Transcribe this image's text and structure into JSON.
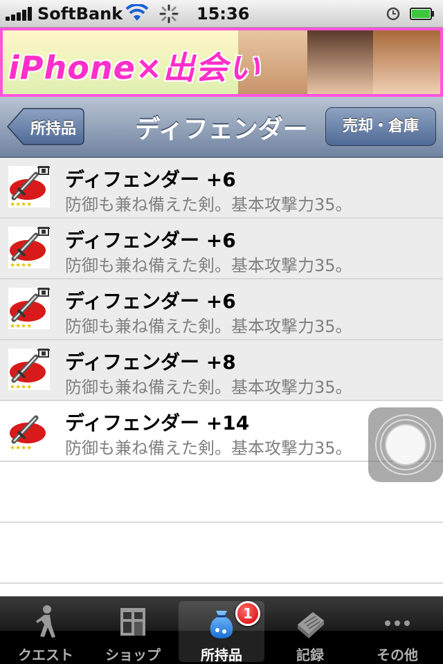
{
  "status_bar": {
    "carrier": "SoftBank",
    "time": "15:36"
  },
  "banner": {
    "text": "iPhone×出会い"
  },
  "nav": {
    "back_label": "所持品",
    "title": "ディフェンダー",
    "right_label": "売却・倉庫"
  },
  "items": [
    {
      "title": "ディフェンダー +6",
      "desc": "防御も兼ね備えた剣。基本攻撃力35。",
      "stored": true
    },
    {
      "title": "ディフェンダー +6",
      "desc": "防御も兼ね備えた剣。基本攻撃力35。",
      "stored": true
    },
    {
      "title": "ディフェンダー +6",
      "desc": "防御も兼ね備えた剣。基本攻撃力35。",
      "stored": true
    },
    {
      "title": "ディフェンダー +8",
      "desc": "防御も兼ね備えた剣。基本攻撃力35。",
      "stored": true
    },
    {
      "title": "ディフェンダー +14",
      "desc": "防御も兼ね備えた剣。基本攻撃力35。",
      "stored": false
    }
  ],
  "tabs": [
    {
      "label": "クエスト",
      "icon": "walker-icon"
    },
    {
      "label": "ショップ",
      "icon": "shop-icon"
    },
    {
      "label": "所持品",
      "icon": "bag-icon",
      "badge": "1",
      "selected": true
    },
    {
      "label": "記録",
      "icon": "notebook-icon"
    },
    {
      "label": "その他",
      "icon": "more-icon"
    }
  ],
  "colors": {
    "banner_border": "#ff55dd",
    "badge": "#d30000",
    "nav": "#6f83a0"
  }
}
